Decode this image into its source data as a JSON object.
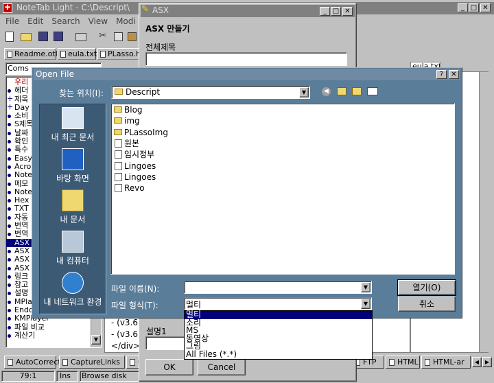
{
  "notetab": {
    "title": "NoteTab Light  -  C:\\Descript\\",
    "menu": [
      "File",
      "Edit",
      "Search",
      "View",
      "Modi"
    ],
    "tabs": [
      "Readme.otl",
      "eula.txt",
      "PLasso.h"
    ],
    "right_tab": "eula.txt",
    "library_select": "Coms",
    "left_items": [
      {
        "text": "우리",
        "style": "red"
      },
      {
        "text": "헤더",
        "style": "b"
      },
      {
        "text": "제목",
        "style": "p"
      },
      {
        "text": "Day",
        "style": "p"
      },
      {
        "text": "소비",
        "style": "b"
      },
      {
        "text": "S제목",
        "style": "b"
      },
      {
        "text": "날짜",
        "style": "b"
      },
      {
        "text": "확인",
        "style": "b"
      },
      {
        "text": "특수",
        "style": "b"
      },
      {
        "text": "Easy",
        "style": "b"
      },
      {
        "text": "Acro",
        "style": "b"
      },
      {
        "text": "Note",
        "style": "b"
      },
      {
        "text": "메모",
        "style": "b"
      },
      {
        "text": "Note",
        "style": "b"
      },
      {
        "text": "Hex",
        "style": "b"
      },
      {
        "text": "TXT",
        "style": "b"
      },
      {
        "text": "자동",
        "style": "b"
      },
      {
        "text": "번역",
        "style": "b"
      },
      {
        "text": "번역",
        "style": "b"
      },
      {
        "text": "ASX",
        "style": "sel"
      },
      {
        "text": "ASX",
        "style": "b"
      },
      {
        "text": "ASX",
        "style": "b"
      },
      {
        "text": "ASX",
        "style": "b"
      },
      {
        "text": "링크",
        "style": "b"
      },
      {
        "text": "참고",
        "style": "b"
      },
      {
        "text": "설명",
        "style": "b"
      },
      {
        "text": "MPla",
        "style": "b"
      },
      {
        "text": "Endo",
        "style": "b"
      },
      {
        "text": "KMPlayer",
        "style": "b"
      },
      {
        "text": "파일 비교",
        "style": "b"
      },
      {
        "text": "계산기",
        "style": "b"
      }
    ],
    "editor_lines": [
      "- (v3.6",
      "- (v3.6",
      "</div>"
    ],
    "bottom_tabs": [
      "AutoCorrect",
      "CaptureLinks",
      "C",
      "FTP",
      "HTML",
      "HTML-ar"
    ],
    "status": {
      "pos": "79:1",
      "mode": "Ins",
      "action": "Browse disk"
    }
  },
  "asx": {
    "title": "ASX",
    "heading": "ASX 만들기",
    "title_label": "전체제목",
    "desc_label": "설명1",
    "ok": "OK",
    "cancel": "Cancel"
  },
  "dialog": {
    "title": "Open File",
    "look_in_label": "찾는 위치(I):",
    "look_in_value": "Descript",
    "places": [
      "내 최근 문서",
      "바탕 화면",
      "내 문서",
      "내 컴퓨터",
      "내 네트워크 환경"
    ],
    "files": [
      {
        "name": "Blog",
        "icon": "folder"
      },
      {
        "name": "img",
        "icon": "folder"
      },
      {
        "name": "PLassoImg",
        "icon": "folder"
      },
      {
        "name": "원본",
        "icon": "doc"
      },
      {
        "name": "임시정부",
        "icon": "doc"
      },
      {
        "name": "Lingoes",
        "icon": "doc"
      },
      {
        "name": "Lingoes",
        "icon": "doc"
      },
      {
        "name": "Revo",
        "icon": "doc"
      }
    ],
    "filename_label": "파일 이름(N):",
    "filename_value": "",
    "filetype_label": "파일 형식(T):",
    "filetype_value": "멀티",
    "open_button": "열기(O)",
    "cancel_button": "취소",
    "filetype_options": [
      "멀티",
      "소리",
      "MS",
      "동영상",
      "그림",
      "All Files (*.*)"
    ],
    "selected_option": 0
  },
  "colors": {
    "titlebar": "#808080",
    "active_title": "#00007b",
    "dialog_face": "#5a7d9a",
    "selection": "#00007b"
  }
}
